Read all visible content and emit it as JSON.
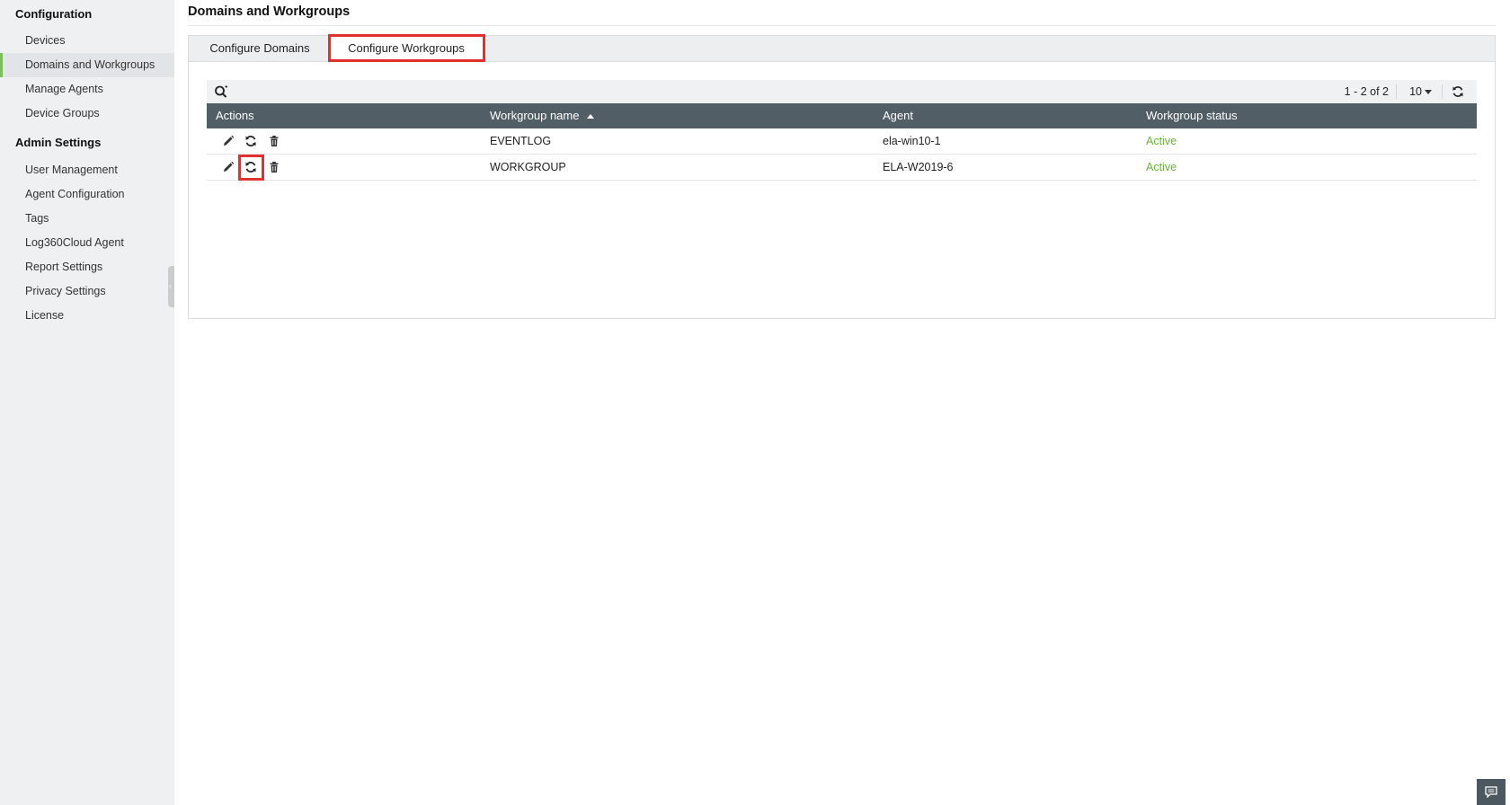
{
  "sidebar": {
    "configuration_title": "Configuration",
    "configuration_items": [
      {
        "label": "Devices"
      },
      {
        "label": "Domains and Workgroups"
      },
      {
        "label": "Manage Agents"
      },
      {
        "label": "Device Groups"
      }
    ],
    "active_item": "Domains and Workgroups",
    "admin_title": "Admin Settings",
    "admin_items": [
      {
        "label": "User Management"
      },
      {
        "label": "Agent Configuration"
      },
      {
        "label": "Tags"
      },
      {
        "label": "Log360Cloud Agent"
      },
      {
        "label": "Report Settings"
      },
      {
        "label": "Privacy Settings"
      },
      {
        "label": "License"
      }
    ]
  },
  "page": {
    "title": "Domains and Workgroups"
  },
  "tabs": [
    {
      "label": "Configure Domains",
      "selected": false
    },
    {
      "label": "Configure Workgroups",
      "selected": true
    }
  ],
  "toolbar": {
    "pager_text": "1 - 2 of 2",
    "per_page": "10"
  },
  "table": {
    "columns": [
      "Actions",
      "Workgroup name",
      "Agent",
      "Workgroup status"
    ],
    "sorted_column": "Workgroup name",
    "sort_direction": "ascending",
    "rows": [
      {
        "name": "EVENTLOG",
        "agent": "ela-win10-1",
        "status": "Active"
      },
      {
        "name": "WORKGROUP",
        "agent": "ELA-W2019-6",
        "status": "Active"
      }
    ]
  },
  "icons": {
    "search": "search-icon",
    "refresh": "refresh-icon",
    "edit": "pencil-icon",
    "sync": "sync-icon",
    "delete": "trash-icon",
    "chat": "chat-icon"
  },
  "colors": {
    "active_nav_accent": "#7cbf5a",
    "table_header_bg": "#515e66",
    "status_active": "#6ab23c",
    "highlight": "#e03030"
  }
}
